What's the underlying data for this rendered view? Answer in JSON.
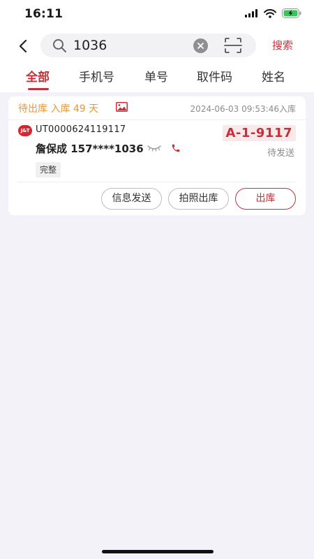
{
  "status_bar": {
    "time": "16:11"
  },
  "search": {
    "query": "1036",
    "button_label": "搜索"
  },
  "tabs": [
    {
      "label": "全部",
      "active": true
    },
    {
      "label": "手机号",
      "active": false
    },
    {
      "label": "单号",
      "active": false
    },
    {
      "label": "取件码",
      "active": false
    },
    {
      "label": "姓名",
      "active": false
    }
  ],
  "parcel": {
    "status_text": "待出库 入库 49 天",
    "storage_time": "2024-06-03 09:53:46入库",
    "carrier_logo": "J&T",
    "tracking_number": "UT0000624119117",
    "shelf_code": "A-1-9117",
    "recipient": "詹保成 157****1036",
    "package_state": "待发送",
    "tag": "完整",
    "actions": {
      "send_info": "信息发送",
      "photo_checkout": "拍照出库",
      "checkout": "出库"
    }
  },
  "colors": {
    "accent": "#c6303a",
    "warning": "#e8963a",
    "background": "#f3f2f8"
  }
}
